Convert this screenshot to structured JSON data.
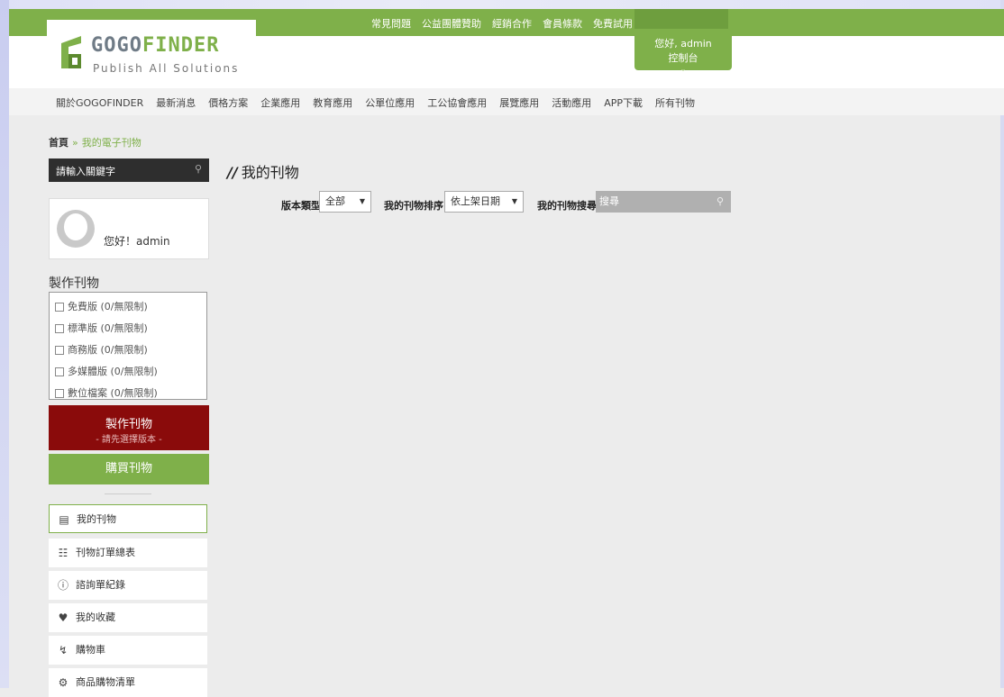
{
  "top_links": [
    "常見問題",
    "公益團體贊助",
    "經銷合作",
    "會員條款",
    "免費試用"
  ],
  "logo": {
    "brand_prefix": "GOGO",
    "brand_suffix": "FINDER",
    "tagline": "Publish All Solutions"
  },
  "admin": {
    "greeting": "您好, admin",
    "console": "控制台",
    "chevron": "⌄"
  },
  "nav": [
    "關於GOGOFINDER",
    "最新消息",
    "價格方案",
    "企業應用",
    "教育應用",
    "公單位應用",
    "工公協會應用",
    "展覽應用",
    "活動應用",
    "APP下載",
    "所有刊物"
  ],
  "breadcrumb": {
    "home": "首頁",
    "sep": "»",
    "current": "我的電子刊物"
  },
  "sidebar": {
    "search_placeholder": "請輸入關鍵字",
    "hello": "您好！admin",
    "make_title": "製作刊物",
    "types": [
      "免費版 (0/無限制)",
      "標準版 (0/無限制)",
      "商務版 (0/無限制)",
      "多媒體版 (0/無限制)",
      "數位檔案 (0/無限制)"
    ],
    "make_button": {
      "label": "製作刊物",
      "sub": "- 請先選擇版本 -"
    },
    "buy_button": "購買刊物",
    "menu": [
      {
        "label": "我的刊物",
        "icon": "books-icon"
      },
      {
        "label": "刊物訂單總表",
        "icon": "order-list-icon"
      },
      {
        "label": "諮詢單紀錄",
        "icon": "consult-icon"
      },
      {
        "label": "我的收藏",
        "icon": "heart-icon"
      },
      {
        "label": "購物車",
        "icon": "cart-icon"
      },
      {
        "label": "商品購物清單",
        "icon": "shopping-list-icon"
      }
    ]
  },
  "main": {
    "title": "我的刊物",
    "filters": {
      "type_label": "版本類型",
      "type_value": "全部",
      "sort_label": "我的刊物排序",
      "sort_value": "依上架日期",
      "search_label": "我的刊物搜尋",
      "search_placeholder": "搜尋"
    }
  },
  "colors": {
    "green": "#7fb04a",
    "dark_red": "#8a0b0b",
    "dark": "#2e2e2e"
  }
}
